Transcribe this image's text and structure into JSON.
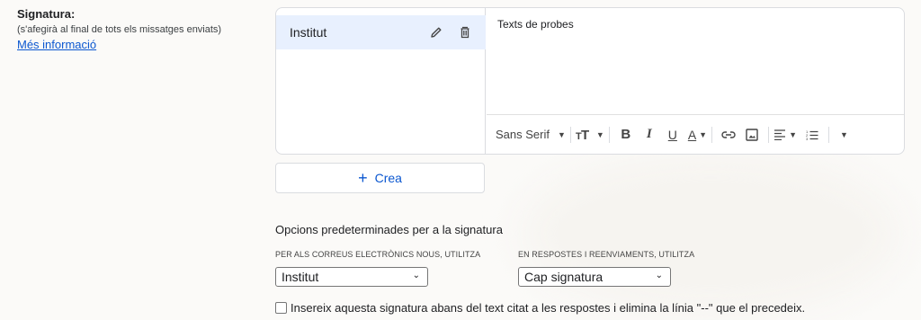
{
  "signature": {
    "label": "Signatura:",
    "sublabel": "(s'afegirà al final de tots els missatges enviats)",
    "more_info": "Més informació"
  },
  "signature_list": {
    "items": [
      {
        "name": "Institut",
        "selected": true
      }
    ]
  },
  "editor": {
    "text": "Texts de probes",
    "toolbar": {
      "font": "Sans Serif",
      "icons": [
        "font-size-icon",
        "bold-icon",
        "italic-icon",
        "underline-icon",
        "text-color-icon",
        "link-icon",
        "image-icon",
        "align-icon",
        "numbered-list-icon",
        "more-icon"
      ],
      "bold": "B",
      "italic": "I",
      "underline": "U",
      "text_color": "A"
    }
  },
  "create_button": {
    "label": "Crea"
  },
  "defaults": {
    "title": "Opcions predeterminades per a la signatura",
    "new_mail_label": "PER ALS CORREUS ELECTRÒNICS NOUS, UTILITZA",
    "new_mail_value": "Institut",
    "replies_label": "EN RESPOSTES I REENVIAMENTS, UTILITZA",
    "replies_value": "Cap signatura",
    "insert_before_label": "Insereix aquesta signatura abans del text citat a les respostes i elimina la línia \"--\" que el precedeix.",
    "insert_before_checked": false
  },
  "colors": {
    "accent": "#0b57d0",
    "selected_bg": "#e8f0fe",
    "border": "#dadce0"
  }
}
